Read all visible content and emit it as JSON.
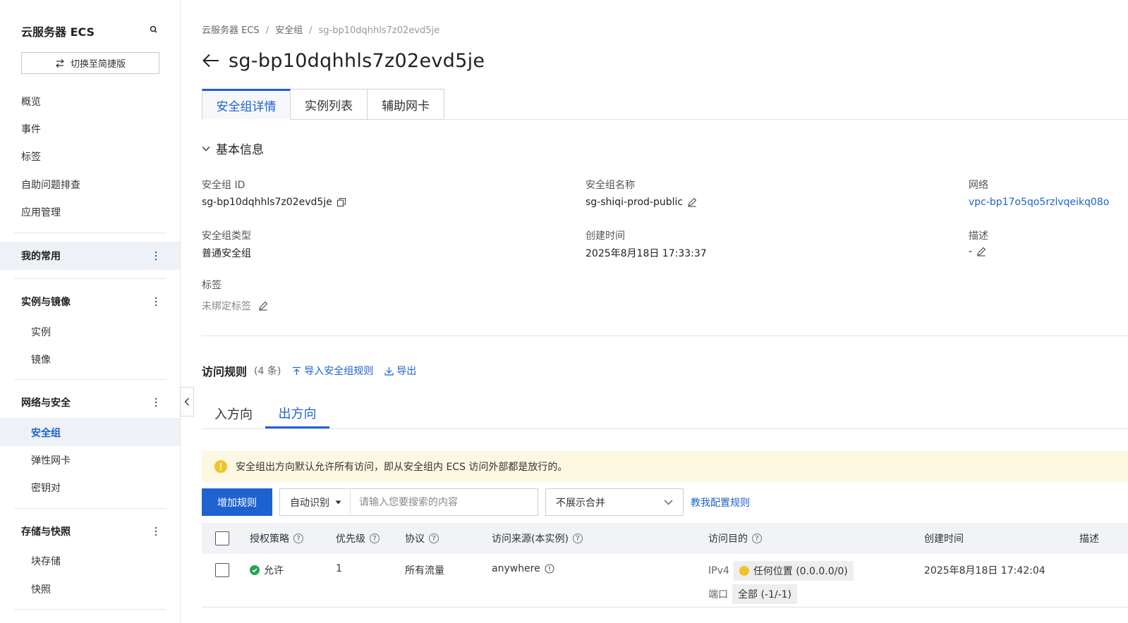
{
  "sidebar": {
    "title": "云服务器 ECS",
    "switch_label": "切换至简捷版",
    "top_items": [
      "概览",
      "事件",
      "标签",
      "自助问题排查",
      "应用管理"
    ],
    "favorites": "我的常用",
    "groups": [
      {
        "label": "实例与镜像",
        "items": [
          "实例",
          "镜像"
        ]
      },
      {
        "label": "网络与安全",
        "items": [
          "安全组",
          "弹性网卡",
          "密钥对"
        ]
      },
      {
        "label": "存储与快照",
        "items": [
          "块存储",
          "快照"
        ]
      }
    ],
    "active_item": "安全组"
  },
  "breadcrumb": [
    "云服务器 ECS",
    "安全组",
    "sg-bp10dqhhls7z02evd5je"
  ],
  "page_title": "sg-bp10dqhhls7z02evd5je",
  "tabs": [
    "安全组详情",
    "实例列表",
    "辅助网卡"
  ],
  "basic_info": {
    "section_title": "基本信息",
    "fields": {
      "sg_id": {
        "label": "安全组 ID",
        "value": "sg-bp10dqhhls7z02evd5je"
      },
      "sg_name": {
        "label": "安全组名称",
        "value": "sg-shiqi-prod-public"
      },
      "network": {
        "label": "网络",
        "value": "vpc-bp17o5qo5rzlvqeikq08o"
      },
      "sg_type": {
        "label": "安全组类型",
        "value": "普通安全组"
      },
      "created": {
        "label": "创建时间",
        "value": "2025年8月18日 17:33:37"
      },
      "desc": {
        "label": "描述",
        "value": "-"
      },
      "tags": {
        "label": "标签",
        "value": "未绑定标签"
      }
    }
  },
  "rules": {
    "title": "访问规则",
    "count": "(4 条)",
    "import_label": "导入安全组规则",
    "export_label": "导出",
    "directions": [
      "入方向",
      "出方向"
    ],
    "active_direction": "出方向",
    "notice": "安全组出方向默认允许所有访问，即从安全组内 ECS 访问外部都是放行的。",
    "add_button": "增加规则",
    "search_type": "自动识别",
    "search_placeholder": "请输入您要搜索的内容",
    "merge_option": "不展示合并",
    "help_link": "教我配置规则",
    "columns": [
      "授权策略",
      "优先级",
      "协议",
      "访问来源(本实例)",
      "访问目的",
      "创建时间",
      "描述"
    ],
    "rows": [
      {
        "policy": "允许",
        "priority": "1",
        "protocol": "所有流量",
        "source": "anywhere",
        "dest_ip_label": "IPv4",
        "dest_ip": "任何位置 (0.0.0.0/0)",
        "dest_port_label": "端口",
        "dest_port": "全部 (-1/-1)",
        "created": "2025年8月18日 17:42:04"
      }
    ]
  },
  "colors": {
    "accent": "#1e62d0",
    "notice_bg": "#fdf8e1",
    "allow": "#23a455",
    "warn": "#f0c32b"
  }
}
